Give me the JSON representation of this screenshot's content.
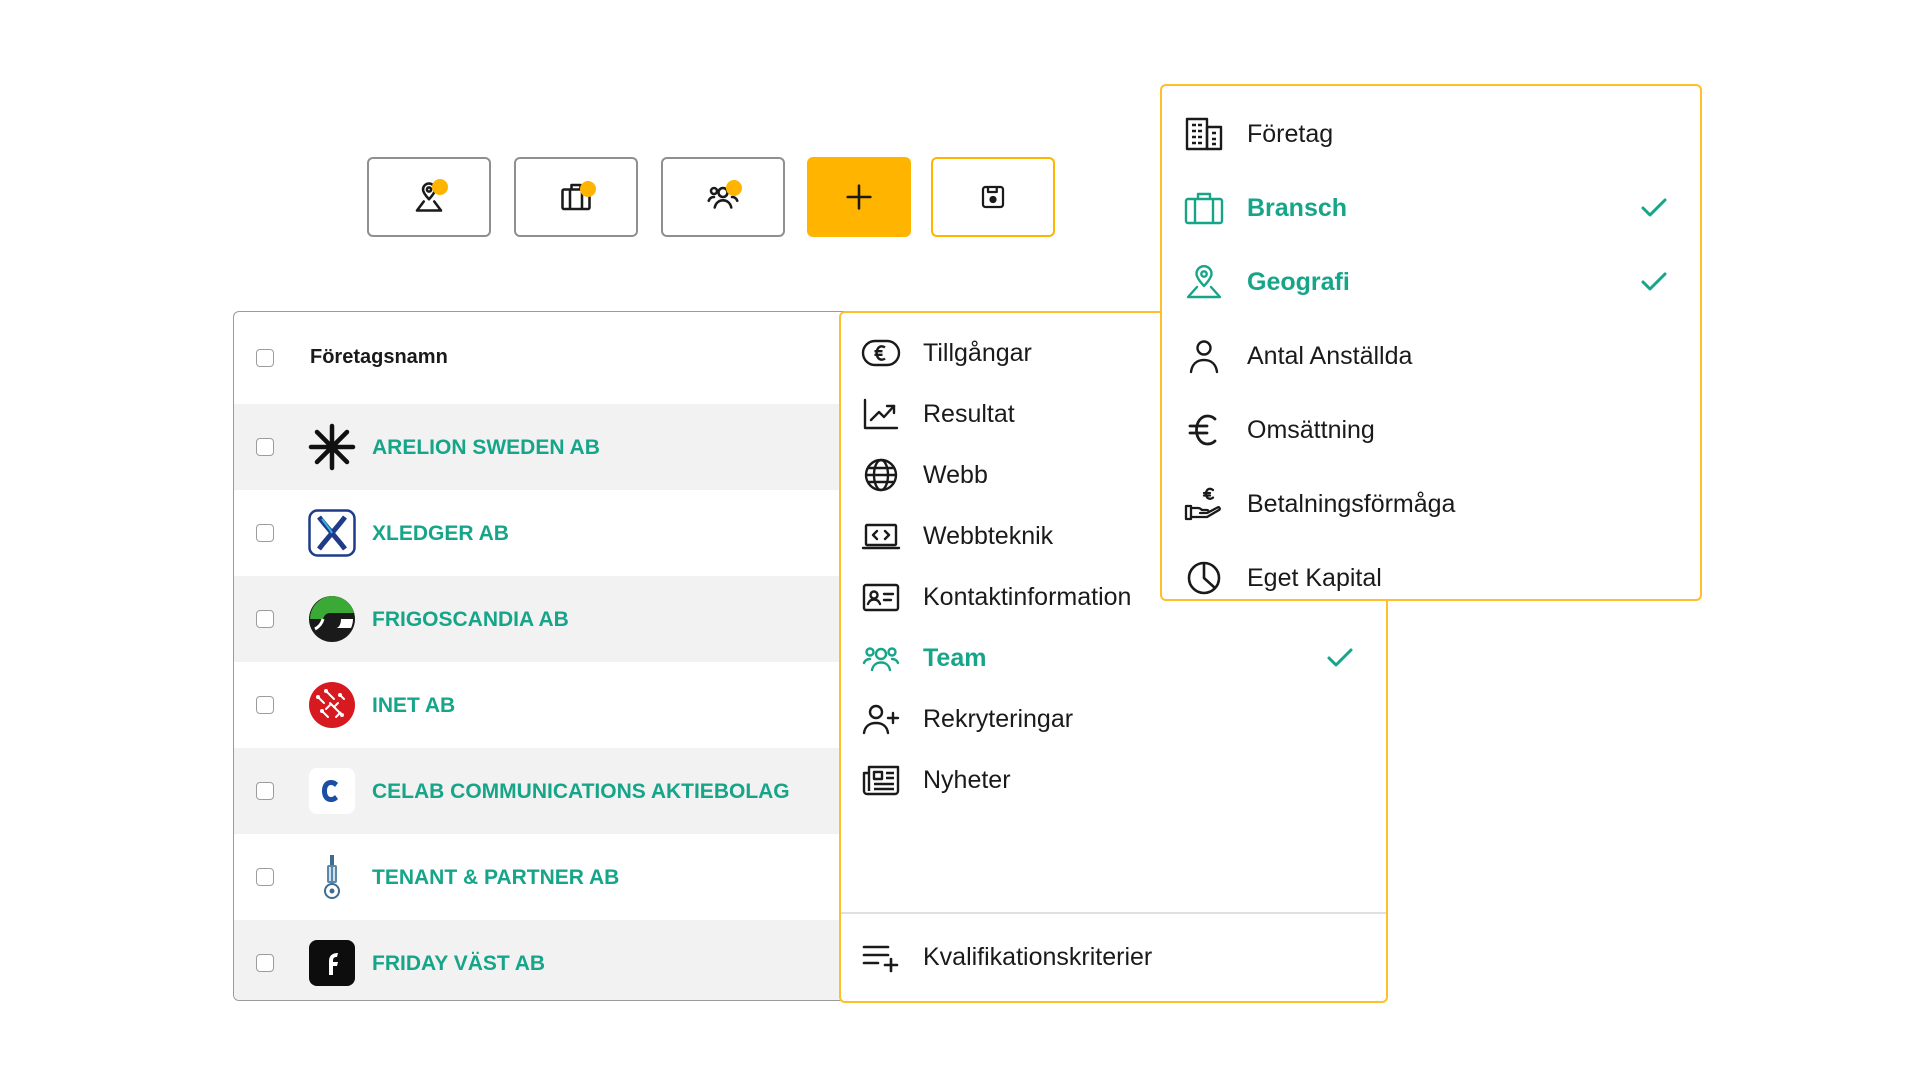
{
  "toolbar": {
    "buttons": [
      {
        "name": "geography-filter",
        "icon": "map-pin-icon",
        "badge": true
      },
      {
        "name": "industry-filter",
        "icon": "briefcase-icon",
        "badge": true
      },
      {
        "name": "team-filter",
        "icon": "users-icon",
        "badge": true
      },
      {
        "name": "add",
        "icon": "plus-icon"
      },
      {
        "name": "save",
        "icon": "save-icon"
      }
    ],
    "colors": {
      "accent": "#ffb400",
      "border": "#8f8f8f"
    }
  },
  "table": {
    "header": "Företagsnamn",
    "rows": [
      {
        "name": "ARELION SWEDEN AB",
        "logo": "arelion-logo"
      },
      {
        "name": "XLEDGER AB",
        "logo": "xledger-logo"
      },
      {
        "name": "FRIGOSCANDIA AB",
        "logo": "frigoscandia-logo"
      },
      {
        "name": "INET AB",
        "logo": "inet-logo"
      },
      {
        "name": "CELAB COMMUNICATIONS AKTIEBOLAG",
        "logo": "celab-logo"
      },
      {
        "name": "TENANT & PARTNER AB",
        "logo": "tenant-logo"
      },
      {
        "name": "FRIDAY VÄST AB",
        "logo": "friday-logo"
      }
    ],
    "link_color": "#17a589"
  },
  "column_menu": {
    "items": [
      {
        "label": "Tillgångar",
        "icon": "euro-coin-icon",
        "checked": false
      },
      {
        "label": "Resultat",
        "icon": "trend-chart-icon",
        "checked": false
      },
      {
        "label": "Webb",
        "icon": "globe-icon",
        "checked": false
      },
      {
        "label": "Webbteknik",
        "icon": "code-laptop-icon",
        "checked": false
      },
      {
        "label": "Kontaktinformation",
        "icon": "contact-card-icon",
        "checked": false
      },
      {
        "label": "Team",
        "icon": "users-icon",
        "checked": true
      },
      {
        "label": "Rekryteringar",
        "icon": "user-plus-icon",
        "checked": false
      },
      {
        "label": "Nyheter",
        "icon": "newspaper-icon",
        "checked": false
      },
      {
        "label": "Kvalifikationskriterier",
        "icon": "list-plus-icon",
        "checked": false
      }
    ]
  },
  "category_menu": {
    "items": [
      {
        "label": "Företag",
        "icon": "building-icon",
        "checked": false
      },
      {
        "label": "Bransch",
        "icon": "briefcase-icon",
        "checked": true
      },
      {
        "label": "Geografi",
        "icon": "map-pin-icon",
        "checked": true
      },
      {
        "label": "Antal Anställda",
        "icon": "user-icon",
        "checked": false
      },
      {
        "label": "Omsättning",
        "icon": "euro-icon",
        "checked": false
      },
      {
        "label": "Betalningsförmåga",
        "icon": "hand-coin-icon",
        "checked": false
      },
      {
        "label": "Eget Kapital",
        "icon": "pie-chart-icon",
        "checked": false
      }
    ]
  },
  "colors": {
    "menu_border": "#ffbf2a",
    "active": "#17a589",
    "row_alt": "#f2f2f2"
  }
}
